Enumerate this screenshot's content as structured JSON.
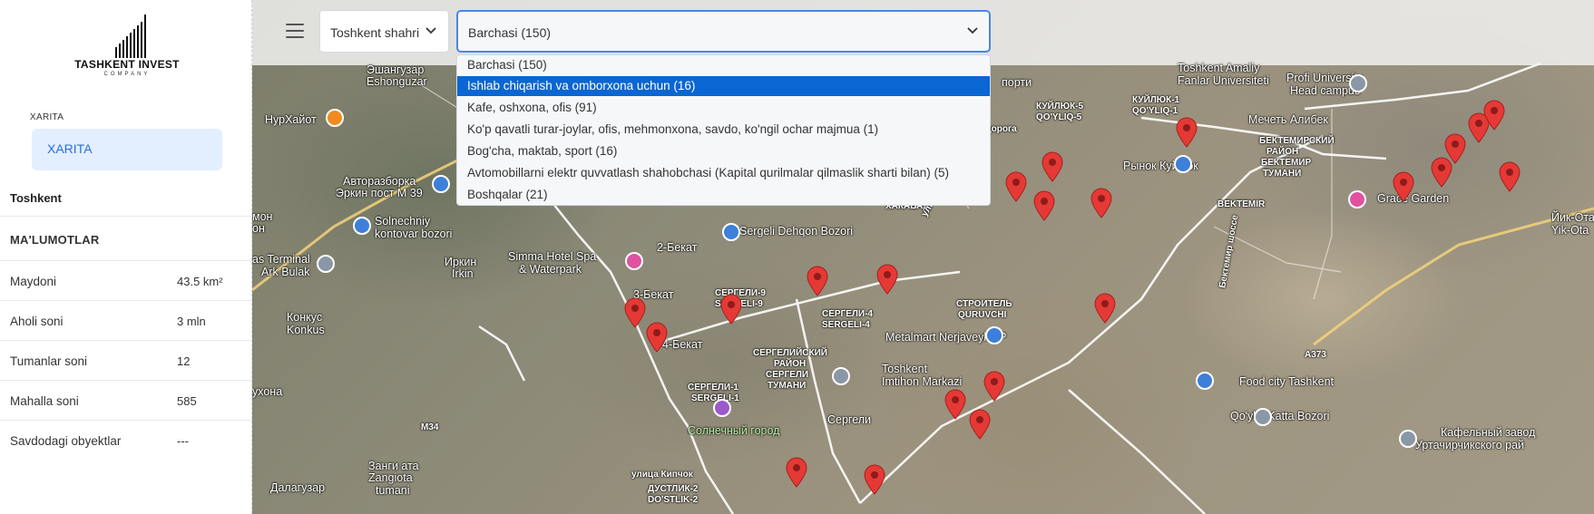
{
  "sidebar": {
    "logo": {
      "name": "TASHKENT INVEST",
      "sub": "COMPANY"
    },
    "map_section_label": "XARITA",
    "map_button": "XARITA",
    "city": "Toshkent",
    "info_title": "MA'LUMOTLAR",
    "info": [
      {
        "label": "Maydoni",
        "value": "43.5 km²"
      },
      {
        "label": "Aholi soni",
        "value": "3 mln"
      },
      {
        "label": "Tumanlar soni",
        "value": "12"
      },
      {
        "label": "Mahalla soni",
        "value": "585"
      },
      {
        "label": "Savdodagi obyektlar",
        "value": "---"
      }
    ]
  },
  "toolbar": {
    "menu_icon": "hamburger-icon",
    "region_value": "Toshkent shahri",
    "category_value": "Barchasi (150)",
    "dropdown_open": true,
    "options": [
      {
        "label": "Barchasi (150)",
        "selected": false
      },
      {
        "label": "Ishlab chiqarish va omborxona uchun (16)",
        "selected": true
      },
      {
        "label": "Kafe, oshxona, ofis (91)",
        "selected": false
      },
      {
        "label": "Ko'p qavatli turar-joylar, ofis, mehmonxona, savdo, ko'ngil ochar majmua (1)",
        "selected": false
      },
      {
        "label": "Bog'cha, maktab, sport (16)",
        "selected": false
      },
      {
        "label": "Avtomobillarni elektr quvvatlash shahobchasi (Kapital qurilmalar qilmaslik sharti bilan) (5)",
        "selected": false
      },
      {
        "label": "Boshqalar (21)",
        "selected": false
      }
    ]
  },
  "map": {
    "pin_color": "#e53935",
    "labels": [
      "Эшангузар",
      "Eshonguzar",
      "НурХайот",
      "Авторазборка",
      "Эркин пост М 39",
      "мон",
      "он",
      "Solnechniy",
      "kontovar bozori",
      "as Terminal",
      "Ark Bulak",
      "Иркин",
      "Irkin",
      "Конкус",
      "Konkus",
      "ухона",
      "Simma Hotel Spa",
      "& Waterpark",
      "2-Бекат",
      "3-Бекат",
      "4-Бекат",
      "СЕРГЕЛИ-9",
      "SERGELI-9",
      "СЕРГЕЛИЙСКИЙ",
      "РАЙОН",
      "СЕРГЕЛИ",
      "ТУМАНИ",
      "СЕРГЕЛИ-1",
      "SERGELI-1",
      "Солнечный город",
      "Sergeli Dehqon Bozori",
      "ХАКАБАД",
      "СЕРГЕЛИ-4",
      "SERGELI-4",
      "СТРОИТЕЛЬ",
      "QURUVCHI",
      "Metalmart Nerjaveyka P",
      "Toshkent",
      "Imtihon Markazi",
      "Сергели",
      "Занги ата",
      "Zangiota",
      "tumani",
      "ДУСТЛИК-2",
      "DO'STLIK-2",
      "Далагузар",
      "улица Кипчок",
      "улица Дадахужаева",
      "порти",
      "автодорога",
      "Toshkent Amaliy",
      "Fanlar Universiteti",
      "КУЙЛЮК-5",
      "QO'YLIQ-5",
      "КУЙЛЮК-1",
      "QO'YLIQ-1",
      "Рынок Куйлюк",
      "Profi University",
      "Head campus",
      "Мечеть Алибек",
      "БЕКТЕМИРСКИЙ",
      "РАЙОН",
      "БЕКТЕМИР",
      "ТУМАНИ",
      "BEKTEMIR",
      "Grace Garden",
      "Йик-Ота",
      "Yik-Ota",
      "Food city Tashkent",
      "Qo'yliq Katta Bozori",
      "Кафельный завод",
      "Уртачирчикского рай",
      "M34",
      "A373",
      "Бектемир шоссе"
    ]
  }
}
